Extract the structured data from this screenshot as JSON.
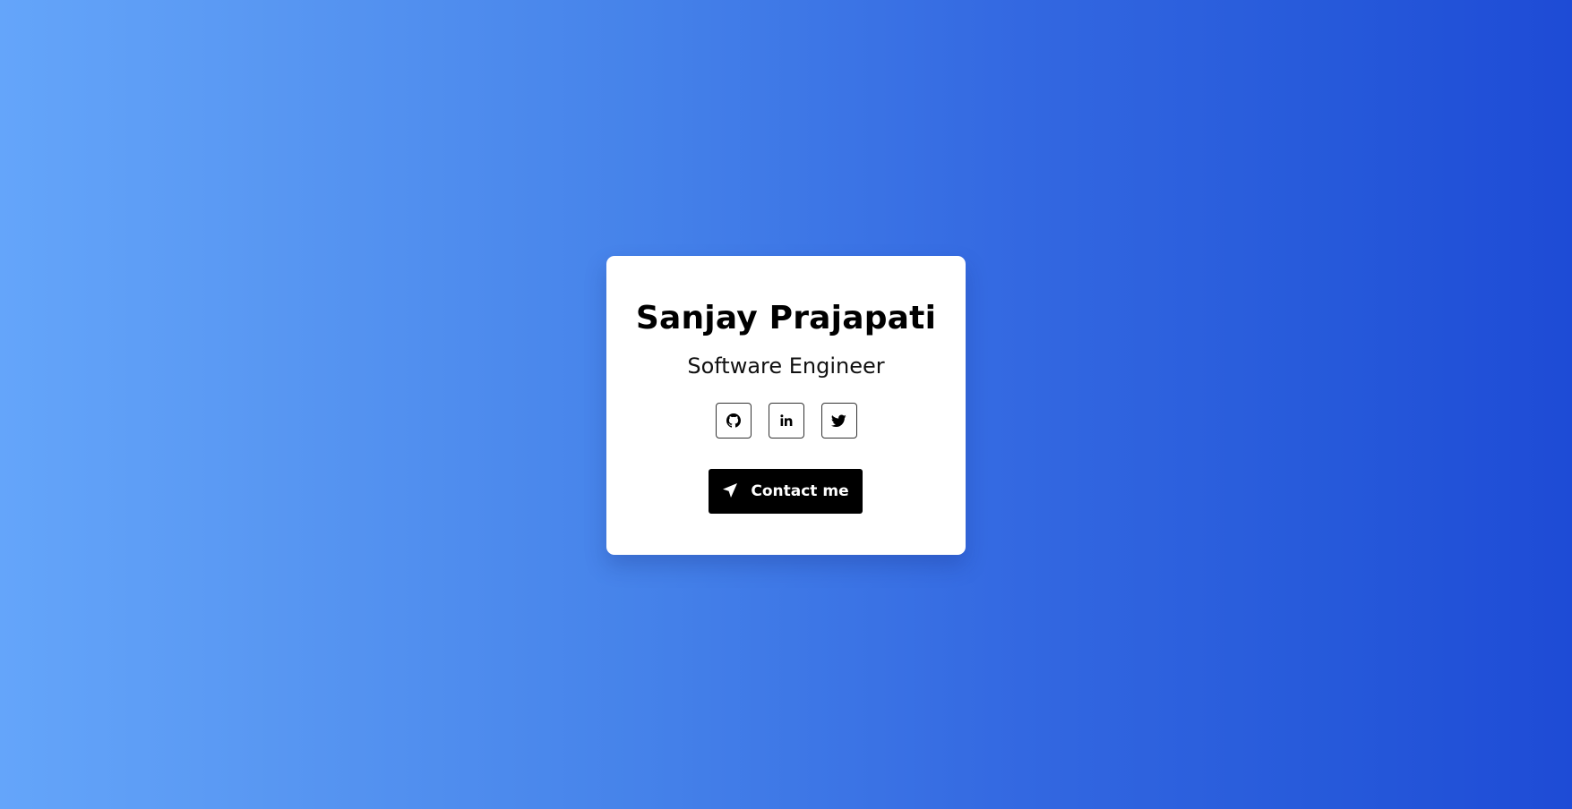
{
  "profile": {
    "name": "Sanjay Prajapati",
    "role": "Software Engineer"
  },
  "socials": [
    {
      "icon": "github-icon",
      "network": "GitHub"
    },
    {
      "icon": "linkedin-icon",
      "network": "LinkedIn",
      "glyph": "in"
    },
    {
      "icon": "twitter-icon",
      "network": "Twitter"
    }
  ],
  "contact": {
    "label": "Contact me",
    "icon": "send-icon"
  },
  "colors": {
    "gradient_start": "#64a5fa",
    "gradient_end": "#1e4bd6",
    "card": "#ffffff",
    "button": "#000000"
  }
}
